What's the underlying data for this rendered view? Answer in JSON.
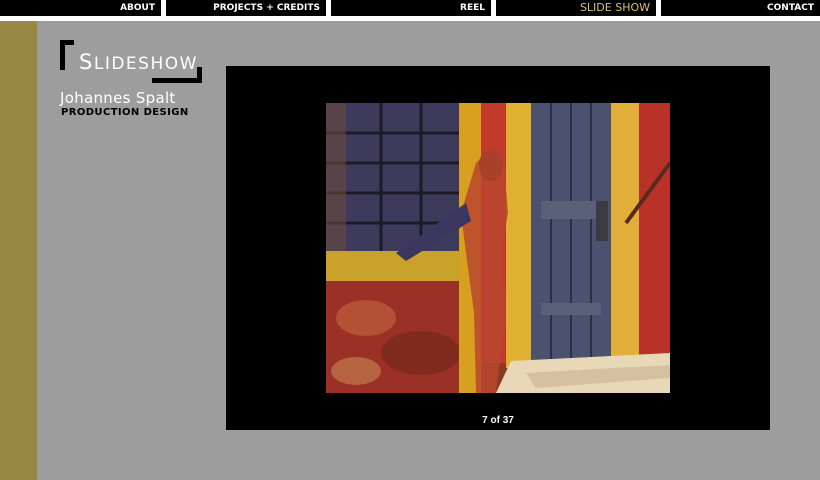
{
  "nav": {
    "about": "ABOUT",
    "projects": "PROJECTS + CREDITS",
    "reel": "REEL",
    "slideshow": "SLIDE SHOW",
    "contact": "CONTACT"
  },
  "logo": {
    "word_cap": "S",
    "word_rest": "LIDESHOW"
  },
  "designer": {
    "name": "Johannes Spalt",
    "title": "PRODUCTION DESIGN"
  },
  "viewer": {
    "counter": "7 of 37"
  },
  "colors": {
    "background": "#9d9d9d",
    "accent_bar": "#978944",
    "nav_active": "#d8c070"
  }
}
